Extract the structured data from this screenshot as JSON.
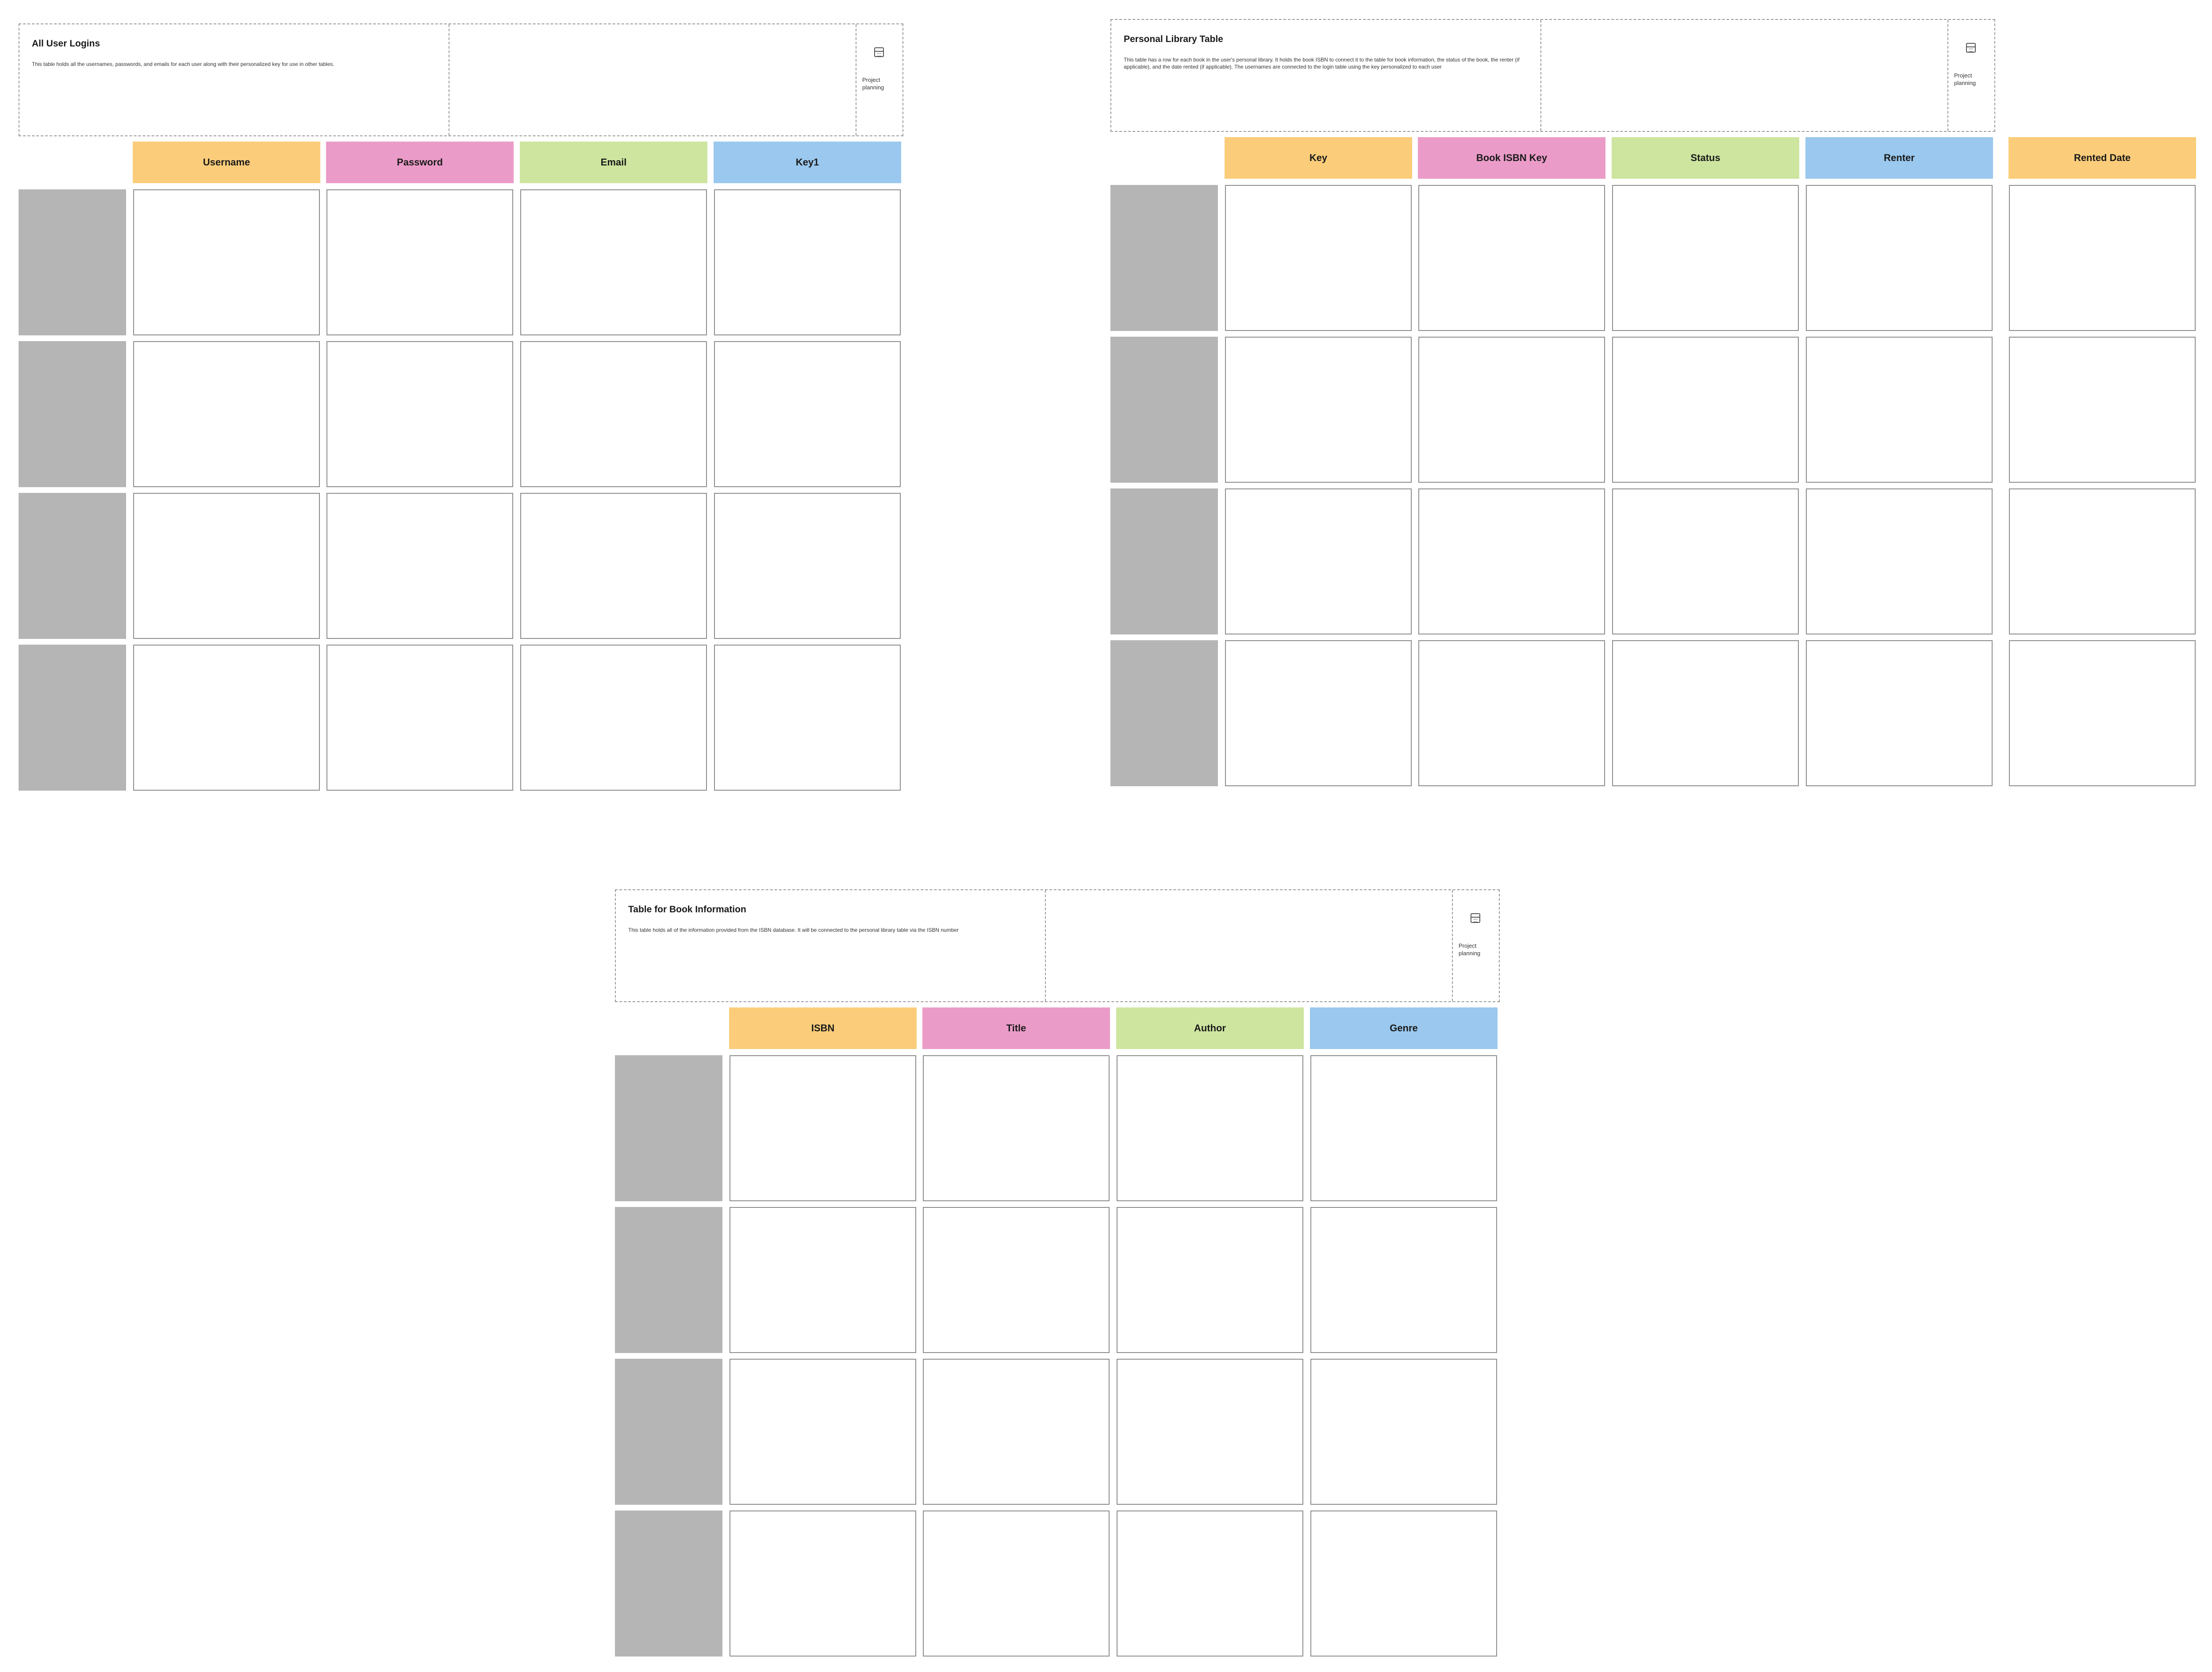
{
  "colors": {
    "orange": "#fbcd7a",
    "pink": "#eb9bc8",
    "green": "#cde59f",
    "blue": "#9ac8ee",
    "row_label": "#b5b5b5"
  },
  "icon": "calendar-icon",
  "frames": [
    {
      "title": "All User Logins",
      "description": "This table holds all the usernames, passwords, and emails for each user along with their personalized key for use in other tables.",
      "tag": "Project planning",
      "columns": [
        "Username",
        "Password",
        "Email",
        "Key1"
      ],
      "rows": 4
    },
    {
      "title": "Personal Library Table",
      "description": "This table has a row for each book in the user's personal library. It holds the book ISBN to connect it to the table for book information, the status of the book, the renter (if applicable), and the date rented (if applicable). The usernames are connected to the login table using the key personalized to each user",
      "tag": "Project planning",
      "columns": [
        "Key",
        "Book ISBN Key",
        "Status",
        "Renter",
        "Rented Date"
      ],
      "rows": 4
    },
    {
      "title": "Table for Book Information",
      "description": "This table holds all of the information provided from the ISBN database. It will be connected to the personal library table via the ISBN number",
      "tag": "Project planning",
      "columns": [
        "ISBN",
        "Title",
        "Author",
        "Genre"
      ],
      "rows": 4
    }
  ]
}
